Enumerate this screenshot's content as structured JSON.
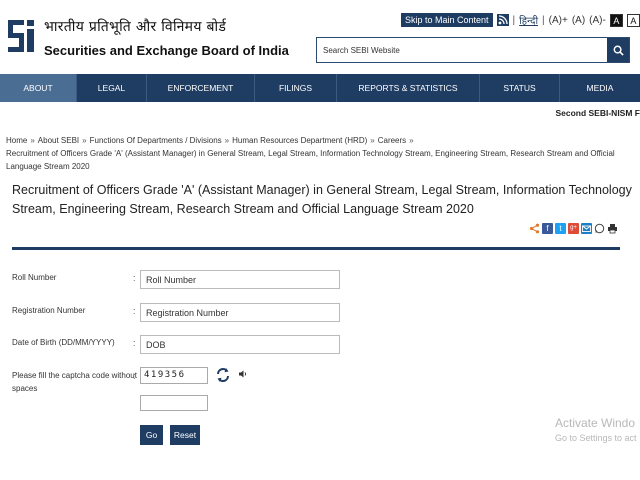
{
  "header": {
    "org_hindi": "भारतीय प्रतिभूति और विनिमय बोर्ड",
    "org_english": "Securities and Exchange Board of India",
    "skip_label": "Skip to Main Content",
    "rss_label": "RSS",
    "hindi_link": "हिन्दी",
    "font_increase": "(A)+",
    "font_normal": "(A)",
    "font_decrease": "(A)-",
    "contrast_dark": "A",
    "contrast_light": "A",
    "search_placeholder": "Search SEBI Website"
  },
  "nav": {
    "items": [
      {
        "label": "ABOUT",
        "active": true
      },
      {
        "label": "LEGAL",
        "active": false
      },
      {
        "label": "ENFORCEMENT",
        "active": false
      },
      {
        "label": "FILINGS",
        "active": false
      },
      {
        "label": "REPORTS & STATISTICS",
        "active": false
      },
      {
        "label": "STATUS",
        "active": false
      },
      {
        "label": "MEDIA",
        "active": false
      }
    ]
  },
  "ticker": "Second SEBI-NISM F",
  "breadcrumb": {
    "items": [
      "Home",
      "About SEBI",
      "Functions Of Departments / Divisions",
      "Human Resources Department (HRD)",
      "Careers",
      "Recruitment of Officers Grade 'A' (Assistant Manager) in General Stream, Legal Stream, Information Technology Stream, Engineering Stream, Research Stream and Official Language Stream 2020"
    ]
  },
  "page_title": "Recruitment of Officers Grade 'A' (Assistant Manager) in General Stream, Legal Stream, Information Technology Stream, Engineering Stream, Research Stream and Official Language Stream 2020",
  "form": {
    "roll_label": "Roll Number",
    "roll_placeholder": "Roll Number",
    "reg_label": "Registration Number",
    "reg_placeholder": "Registration Number",
    "dob_label": "Date of Birth (DD/MM/YYYY)",
    "dob_placeholder": "DOB",
    "captcha_label_1": "Please fill the captcha code without",
    "captcha_label_2": "spaces",
    "captcha_code": "419356",
    "colon": ":",
    "go_label": "Go",
    "reset_label": "Reset"
  },
  "watermark": {
    "line1": "Activate Windo",
    "line2": "Go to Settings to act"
  },
  "colors": {
    "brand_navy": "#1f3d63",
    "nav_active": "#4a6d94"
  },
  "icons": {
    "share": [
      "share-icon",
      "facebook-icon",
      "twitter-icon",
      "google-plus-icon",
      "email-icon",
      "whatsapp-icon",
      "print-icon"
    ]
  }
}
